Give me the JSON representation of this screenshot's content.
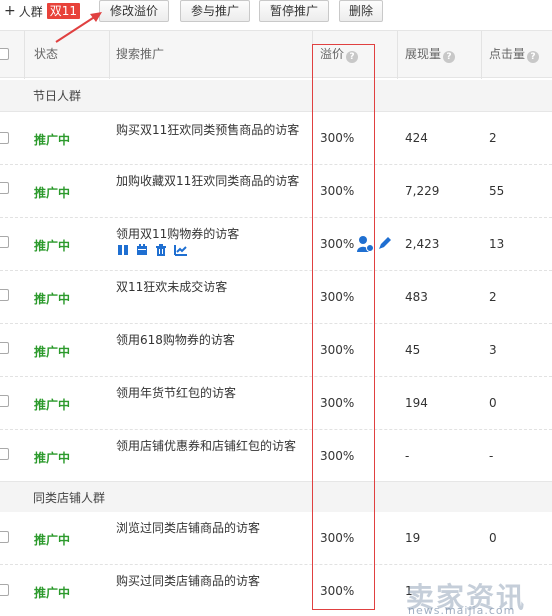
{
  "toolbar": {
    "title": "人群",
    "badge": "双11",
    "buttons": [
      "修改溢价",
      "参与推广",
      "暂停推广",
      "删除"
    ]
  },
  "table": {
    "headers": {
      "status": "状态",
      "promotion": "搜索推广",
      "premium": "溢价",
      "impressions": "展现量",
      "clicks": "点击量"
    },
    "groups": [
      {
        "name": "节日人群",
        "rows": [
          {
            "status": "推广中",
            "name": "购买双11狂欢同类预售商品的访客",
            "premium": "300%",
            "impressions": "424",
            "clicks": "2"
          },
          {
            "status": "推广中",
            "name": "加购收藏双11狂欢同类商品的访客",
            "premium": "300%",
            "impressions": "7,229",
            "clicks": "55"
          },
          {
            "status": "推广中",
            "name": "领用双11购物券的访客",
            "premium": "300%",
            "impressions": "2,423",
            "clicks": "13"
          },
          {
            "status": "推广中",
            "name": "双11狂欢未成交访客",
            "premium": "300%",
            "impressions": "483",
            "clicks": "2"
          },
          {
            "status": "推广中",
            "name": "领用618购物券的访客",
            "premium": "300%",
            "impressions": "45",
            "clicks": "3"
          },
          {
            "status": "推广中",
            "name": "领用年货节红包的访客",
            "premium": "300%",
            "impressions": "194",
            "clicks": "0"
          },
          {
            "status": "推广中",
            "name": "领用店铺优惠券和店铺红包的访客",
            "premium": "300%",
            "impressions": "-",
            "clicks": "-"
          }
        ]
      },
      {
        "name": "同类店铺人群",
        "rows": [
          {
            "status": "推广中",
            "name": "浏览过同类店铺商品的访客",
            "premium": "300%",
            "impressions": "19",
            "clicks": "0"
          },
          {
            "status": "推广中",
            "name": "购买过同类店铺商品的访客",
            "premium": "300%",
            "impressions": "1",
            "clicks": ""
          }
        ]
      }
    ]
  },
  "row_icons": [
    "pause-icon",
    "calendar-icon",
    "trash-icon",
    "chart-icon"
  ],
  "watermark": {
    "big": "卖家资讯",
    "small": "news.maijia.com"
  },
  "colors": {
    "status_green": "#2c9a2c",
    "badge_red": "#e8423a",
    "highlight_red": "#e04040",
    "icon_blue": "#1f6fd1"
  }
}
